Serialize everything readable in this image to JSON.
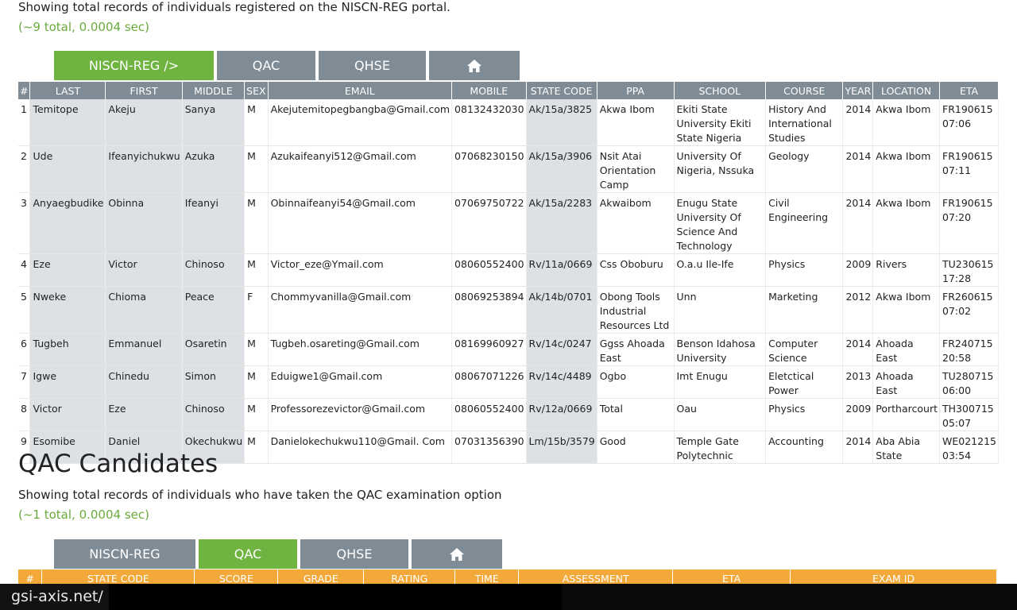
{
  "reg_section": {
    "caption": "Showing total records of individuals registered on the NISCN-REG portal.",
    "meta": "(~9 total, 0.0004 sec)",
    "tabs": [
      {
        "label": "NISCN-REG />",
        "active": true
      },
      {
        "label": "QAC",
        "active": false
      },
      {
        "label": "QHSE",
        "active": false
      },
      {
        "icon": "home-icon",
        "active": false
      }
    ],
    "columns": [
      "#",
      "LAST",
      "FIRST",
      "MIDDLE",
      "SEX",
      "EMAIL",
      "MOBILE",
      "STATE CODE",
      "PPA",
      "SCHOOL",
      "COURSE",
      "YEAR",
      "LOCATION",
      "ETA"
    ],
    "rows": [
      [
        "1",
        "Temitope",
        "Akeju",
        "Sanya",
        "M",
        "Akejutemitopegbangba@Gmail.com",
        "08132432030",
        "Ak/15a/3825",
        "Akwa Ibom",
        "Ekiti State University Ekiti State Nigeria",
        "History And International Studies",
        "2014",
        "Akwa Ibom",
        "FR190615 07:06"
      ],
      [
        "2",
        "Ude",
        "Ifeanyichukwu",
        "Azuka",
        "M",
        "Azukaifeanyi512@Gmail.com",
        "07068230150",
        "Ak/15a/3906",
        "Nsit Atai Orientation Camp",
        "University Of Nigeria, Nssuka",
        "Geology",
        "2014",
        "Akwa Ibom",
        "FR190615 07:11"
      ],
      [
        "3",
        "Anyaegbudike",
        "Obinna",
        "Ifeanyi",
        "M",
        "Obinnaifeanyi54@Gmail.com",
        "07069750722",
        "Ak/15a/2283",
        "Akwaibom",
        "Enugu State University Of Science And Technology",
        "Civil Engineering",
        "2014",
        "Akwa Ibom",
        "FR190615 07:20"
      ],
      [
        "4",
        "Eze",
        "Victor",
        "Chinoso",
        "M",
        "Victor_eze@Ymail.com",
        "08060552400",
        "Rv/11a/0669",
        "Css Oboburu",
        "O.a.u Ile-Ife",
        "Physics",
        "2009",
        "Rivers",
        "TU230615 17:28"
      ],
      [
        "5",
        "Nweke",
        "Chioma",
        "Peace",
        "F",
        "Chommyvanilla@Gmail.com",
        "08069253894",
        "Ak/14b/0701",
        "Obong Tools Industrial Resources Ltd",
        "Unn",
        "Marketing",
        "2012",
        "Akwa Ibom",
        "FR260615 07:02"
      ],
      [
        "6",
        "Tugbeh",
        "Emmanuel",
        "Osaretin",
        "M",
        "Tugbeh.osareting@Gmail.com",
        "08169960927",
        "Rv/14c/0247",
        "Ggss Ahoada East",
        "Benson Idahosa University",
        "Computer Science",
        "2014",
        "Ahoada East",
        "FR240715 20:58"
      ],
      [
        "7",
        "Igwe",
        "Chinedu",
        "Simon",
        "M",
        "Eduigwe1@Gmail.com",
        "08067071226",
        "Rv/14c/4489",
        "Ogbo",
        "Imt Enugu",
        "Eletctical Power",
        "2013",
        "Ahoada East",
        "TU280715 06:00"
      ],
      [
        "8",
        "Victor",
        "Eze",
        "Chinoso",
        "M",
        "Professorezevictor@Gmail.com",
        "08060552400",
        "Rv/12a/0669",
        "Total",
        "Oau",
        "Physics",
        "2009",
        "Portharcourt",
        "TH300715 05:07"
      ],
      [
        "9",
        "Esomibe",
        "Daniel",
        "Okechukwu",
        "M",
        "Danielokechukwu110@Gmail. Com",
        "07031356390",
        "Lm/15b/3579",
        "Good",
        "Temple Gate Polytechnic",
        "Accounting",
        "2014",
        "Aba Abia State",
        "WE021215 03:54"
      ]
    ]
  },
  "qac_section": {
    "title": "QAC Candidates",
    "caption": "Showing total records of individuals who have taken the QAC examination option",
    "meta": "(~1 total, 0.0004 sec)",
    "tabs": [
      {
        "label": "NISCN-REG",
        "active": false
      },
      {
        "label": "QAC",
        "active": true
      },
      {
        "label": "QHSE",
        "active": false
      },
      {
        "icon": "home-icon",
        "active": false
      }
    ],
    "columns": [
      "#",
      "STATE CODE",
      "SCORE",
      "GRADE",
      "RATING",
      "TIME",
      "ASSESSMENT",
      "ETA",
      "EXAM ID"
    ]
  },
  "status_bar": {
    "url": "gsi-axis.net/"
  },
  "colors": {
    "active_tab": "#6fb341",
    "tab": "#7f8c96",
    "meta_green": "#6aaa3a",
    "qac_header": "#f2a93a",
    "shaded_column": "#dde1e5"
  }
}
